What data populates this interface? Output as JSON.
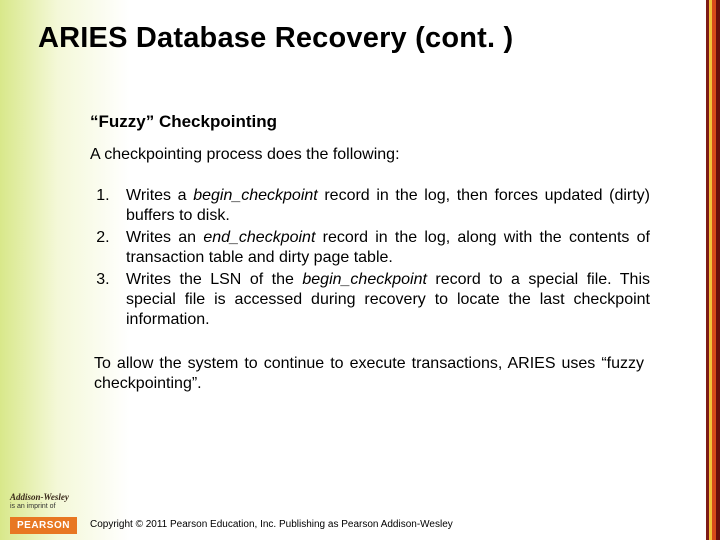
{
  "title": "ARIES Database Recovery (cont. )",
  "subheading": "“Fuzzy” Checkpointing",
  "intro": "A checkpointing process does the following:",
  "steps": [
    {
      "pre": "Writes a ",
      "em": "begin_checkpoint",
      "post": " record in the log, then forces updated (dirty) buffers to disk."
    },
    {
      "pre": "Writes an ",
      "em": "end_checkpoint",
      "post": " record in the log, along with the contents of transaction table and dirty page table."
    },
    {
      "pre": "Writes the LSN of the ",
      "em": "begin_checkpoint",
      "post": " record to a special file.  This special file is accessed during recovery to locate the last checkpoint information."
    }
  ],
  "closing": "To allow the system to continue to execute transactions, ARIES uses “fuzzy checkpointing”.",
  "logo": {
    "brand": "Addison-Wesley",
    "imprint": "is an imprint of"
  },
  "pearson": "PEARSON",
  "copyright": "Copyright © 2011 Pearson Education, Inc. Publishing as Pearson Addison-Wesley"
}
